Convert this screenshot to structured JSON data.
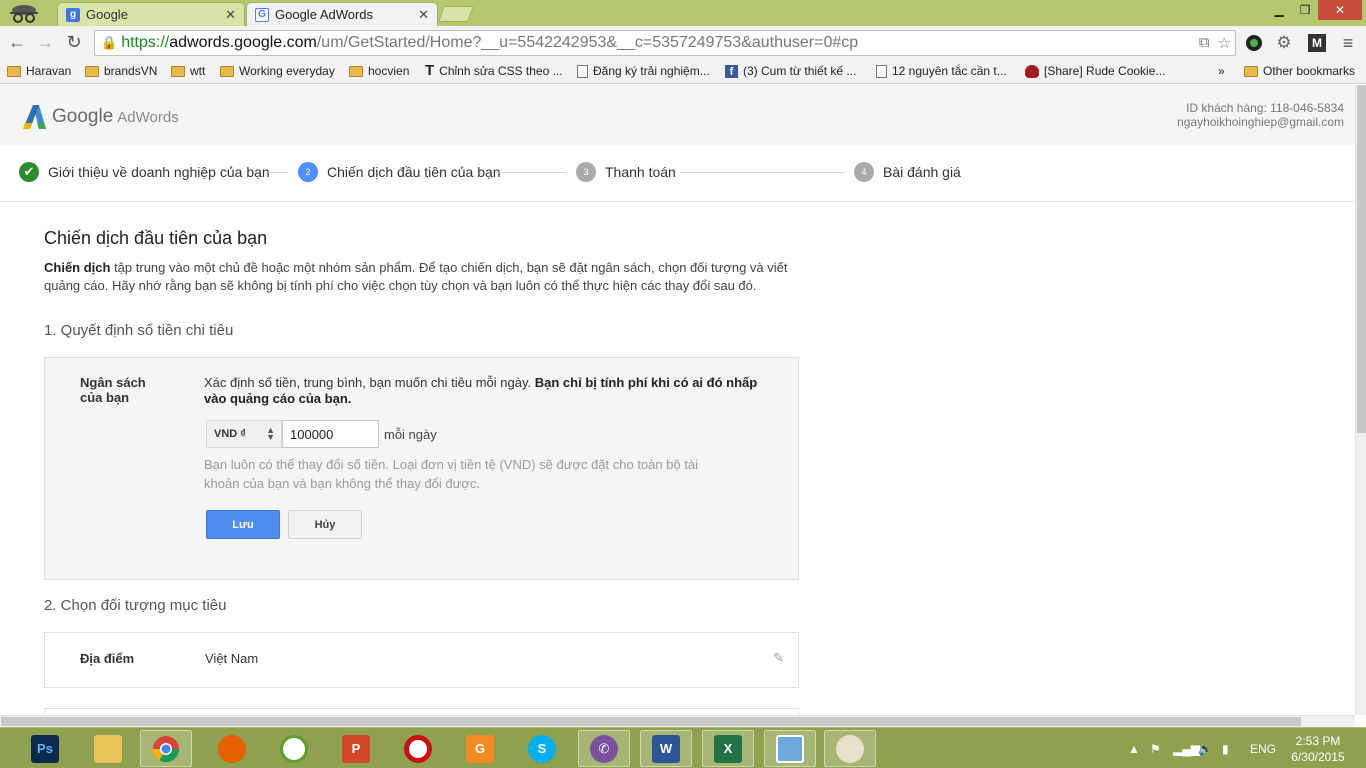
{
  "browser": {
    "tabs": [
      {
        "title": "Google",
        "favicon_letter": "g",
        "favicon_color": "#3b78e7",
        "active": false
      },
      {
        "title": "Google AdWords",
        "favicon_letter": "G",
        "favicon_color": "#4285f4",
        "active": true
      }
    ],
    "url": {
      "scheme": "https://",
      "host": "adwords.google.com",
      "path": "/um/GetStarted/Home?__u=5542242953&__c=5357249753&authuser=0#cp"
    },
    "bookmarks": [
      {
        "label": "Haravan",
        "icon": "folder-icon"
      },
      {
        "label": "brandsVN",
        "icon": "folder-icon"
      },
      {
        "label": "wtt",
        "icon": "folder-icon"
      },
      {
        "label": "Working everyday",
        "icon": "folder-icon"
      },
      {
        "label": "hocvien",
        "icon": "folder-icon"
      },
      {
        "label": "Chỉnh sửa CSS theo ...",
        "icon": "t-icon"
      },
      {
        "label": "Đăng ký trải nghiệm...",
        "icon": "page-icon"
      },
      {
        "label": "(3) Cum từ thiết kế ...",
        "icon": "facebook-icon"
      },
      {
        "label": "12 nguyên tắc cần t...",
        "icon": "page-icon"
      },
      {
        "label": "[Share] Rude Cookie...",
        "icon": "cookie-icon"
      }
    ],
    "bookmarks_overflow": "»",
    "other_bookmarks": "Other bookmarks"
  },
  "header": {
    "logo_google": "Google",
    "logo_product": "AdWords",
    "customer_id": "ID khách hàng: 118-046-5834",
    "email": "ngayhoikhoinghiep@gmail.com"
  },
  "steps": [
    {
      "number": "",
      "label": "Giới thiệu về doanh nghiệp của bạn",
      "state": "done"
    },
    {
      "number": "2",
      "label": "Chiến dịch đầu tiên của bạn",
      "state": "current"
    },
    {
      "number": "3",
      "label": "Thanh toán",
      "state": "todo"
    },
    {
      "number": "4",
      "label": "Bài đánh giá",
      "state": "todo"
    }
  ],
  "main": {
    "title": "Chiến dịch đầu tiên của bạn",
    "intro_bold": "Chiến dịch",
    "intro_rest": " tập trung vào một chủ đề hoặc một nhóm sản phẩm. Để tạo chiến dịch, bạn sẽ đặt ngân sách, chọn đối tượng và viết quảng cáo. Hãy nhớ rằng bạn sẽ không bị tính phí cho việc chọn tùy chọn và bạn luôn có thể thực hiện các thay đổi sau đó.",
    "section1_title": "1. Quyết định số tiền chi tiêu",
    "budget": {
      "label_line1": "Ngân sách",
      "label_line2": "của bạn",
      "desc_plain": "Xác định số tiền, trung bình, bạn muốn chi tiêu mỗi ngày. ",
      "desc_bold": "Bạn chỉ bị tính phí khi có ai đó nhấp vào quảng cáo của bạn.",
      "currency": "VND ₫",
      "amount": "100000",
      "per_day": "mỗi ngày",
      "note": "Bạn luôn có thể thay đổi số tiền. Loại đơn vị tiền tệ (VND) sẽ được đặt cho toàn bộ tài khoản của bạn và bạn không thể thay đổi được.",
      "save_label": "Lưu",
      "cancel_label": "Hủy"
    },
    "section2_title": "2. Chọn đối tượng mục tiêu",
    "location": {
      "label": "Địa điểm",
      "value": "Việt Nam"
    }
  },
  "taskbar": {
    "language": "ENG",
    "time": "2:53 PM",
    "date": "6/30/2015"
  },
  "colors": {
    "accent_blue": "#4d8ff0",
    "done_green": "#2d8c2d",
    "taskbar": "#8fa04f"
  }
}
